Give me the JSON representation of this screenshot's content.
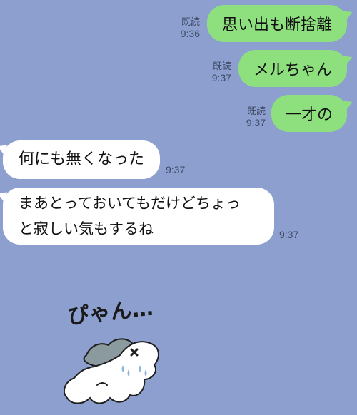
{
  "messages": {
    "outgoing": [
      {
        "text": "思い出も断捨離",
        "read": "既読",
        "time": "9:36"
      },
      {
        "text": "メルちゃん",
        "read": "既読",
        "time": "9:37"
      },
      {
        "text": "一才の",
        "read": "既読",
        "time": "9:37"
      }
    ],
    "incoming": [
      {
        "lines": [
          "何にも無くなった"
        ],
        "time": "9:37"
      },
      {
        "lines": [
          "まあとっておいてもだけどちょっ",
          "と寂しい気もするね"
        ],
        "time": "9:37"
      }
    ]
  },
  "sticker": {
    "text": "ぴゃん…",
    "icon": "crying-ghost-sticker"
  },
  "colors": {
    "background": "#8c9fcf",
    "outgoing_bubble": "#8ee07f",
    "incoming_bubble": "#ffffff",
    "meta_text": "#3e4a66"
  }
}
